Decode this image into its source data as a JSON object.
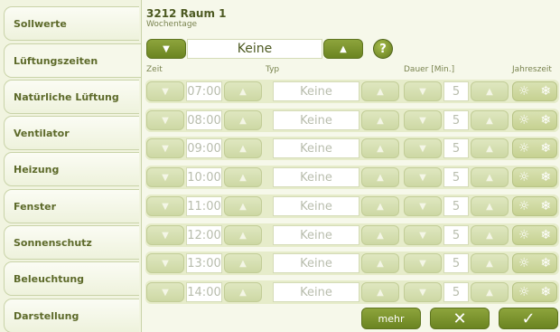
{
  "sidebar": {
    "items": [
      {
        "label": "Sollwerte"
      },
      {
        "label": "Lüftungszeiten"
      },
      {
        "label": "Natürliche Lüftung"
      },
      {
        "label": "Ventilator"
      },
      {
        "label": "Heizung"
      },
      {
        "label": "Fenster"
      },
      {
        "label": "Sonnenschutz"
      },
      {
        "label": "Beleuchtung"
      },
      {
        "label": "Darstellung"
      }
    ],
    "active_index": 1
  },
  "header": {
    "title": "3212 Raum 1",
    "subtitle": "Wochentage",
    "day_selector": {
      "value": "Keine"
    },
    "help_label": "?"
  },
  "columns": {
    "zeit": "Zeit",
    "typ": "Typ",
    "dauer": "Dauer [Min.]",
    "jahreszeit": "Jahreszeit"
  },
  "rows": [
    {
      "time": "07:00",
      "type": "Keine",
      "duration": "5"
    },
    {
      "time": "08:00",
      "type": "Keine",
      "duration": "5"
    },
    {
      "time": "09:00",
      "type": "Keine",
      "duration": "5"
    },
    {
      "time": "10:00",
      "type": "Keine",
      "duration": "5"
    },
    {
      "time": "11:00",
      "type": "Keine",
      "duration": "5"
    },
    {
      "time": "12:00",
      "type": "Keine",
      "duration": "5"
    },
    {
      "time": "13:00",
      "type": "Keine",
      "duration": "5"
    },
    {
      "time": "14:00",
      "type": "Keine",
      "duration": "5"
    }
  ],
  "footer": {
    "more_label": "mehr",
    "cancel_icon": "x-icon",
    "confirm_icon": "check-icon"
  },
  "colors": {
    "accent": "#6b8421",
    "background": "#f6f8ea"
  }
}
